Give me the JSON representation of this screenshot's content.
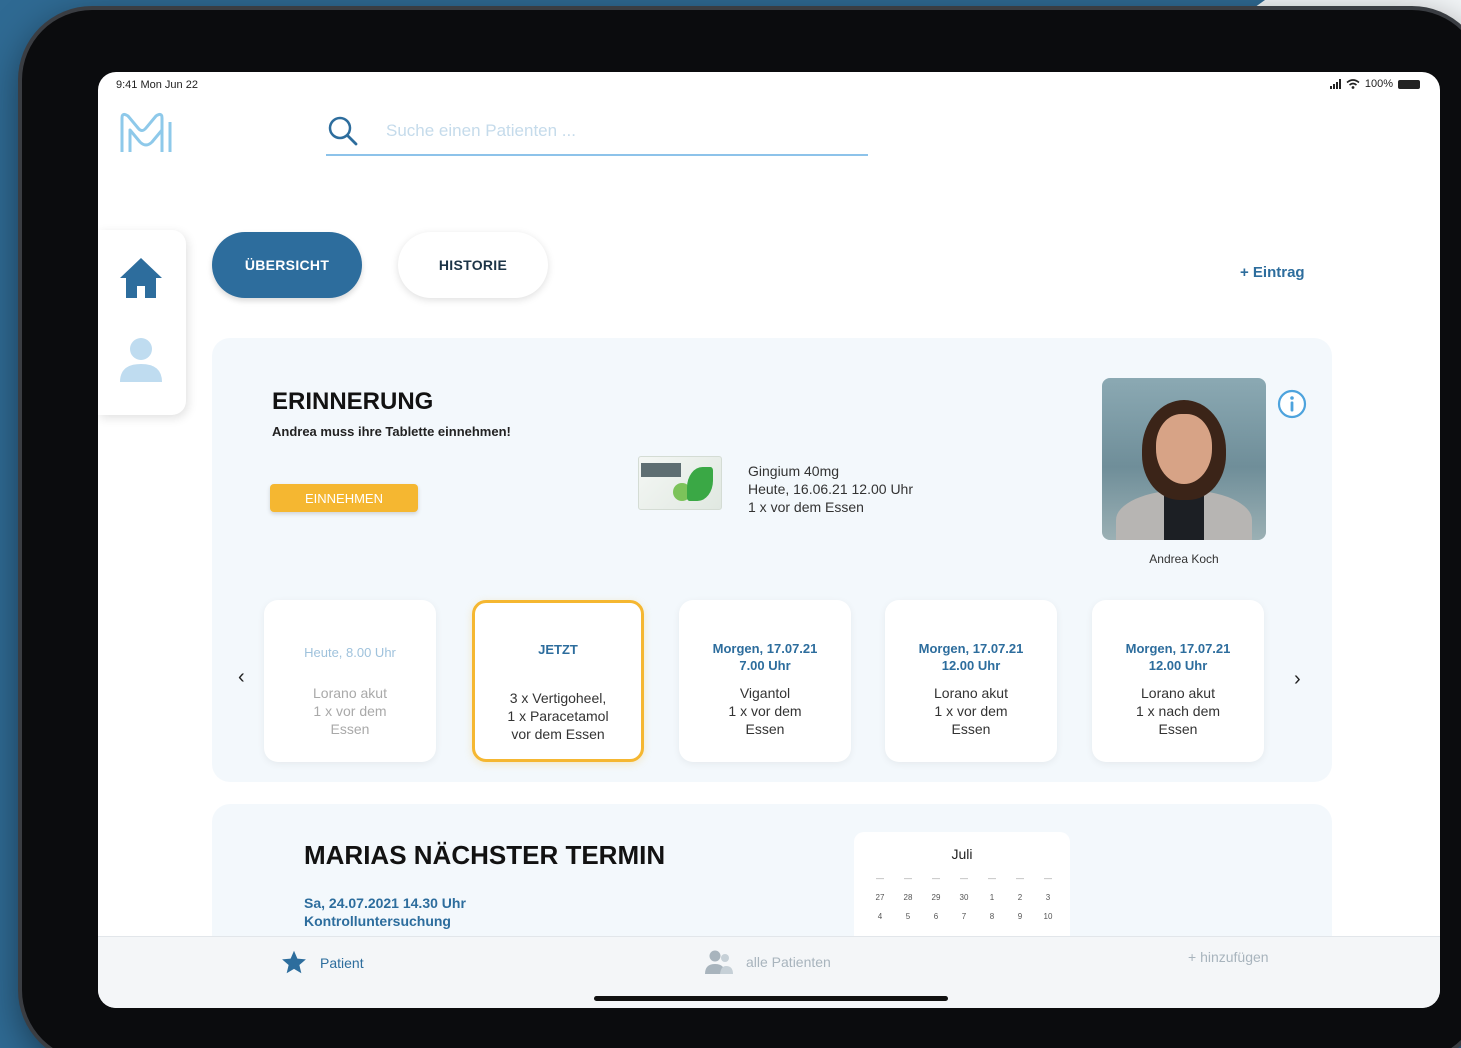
{
  "status_bar": {
    "time": "9:41  Mon Jun 22",
    "battery": "100%"
  },
  "search": {
    "placeholder": "Suche einen Patienten ..."
  },
  "tabs": [
    {
      "label": "ÜBERSICHT",
      "active": true
    },
    {
      "label": "HISTORIE",
      "active": false
    }
  ],
  "add_entry": {
    "label": "+ Eintrag"
  },
  "reminder": {
    "title": "ERINNERUNG",
    "subtitle": "Andrea muss ihre Tablette einnehmen!",
    "button_label": "EINNEHMEN",
    "medication": {
      "name": "Gingium 40mg",
      "time": "Heute, 16.06.21 12.00 Uhr",
      "dose": "1 x vor dem Essen"
    },
    "patient_name": "Andrea Koch"
  },
  "schedule": [
    {
      "when": "Heute, 8.00 Uhr",
      "what": "Lorano akut\n1 x vor dem\nEssen",
      "state": "past"
    },
    {
      "when": "JETZT",
      "what": "3 x Vertigoheel,\n1 x Paracetamol\nvor dem Essen",
      "state": "current"
    },
    {
      "when": "Morgen, 17.07.21\n7.00 Uhr",
      "what": "Vigantol\n1 x vor dem\nEssen",
      "state": "upcoming"
    },
    {
      "when": "Morgen, 17.07.21\n12.00 Uhr",
      "what": "Lorano akut\n1 x vor dem\nEssen",
      "state": "upcoming"
    },
    {
      "when": "Morgen, 17.07.21\n12.00 Uhr",
      "what": "Lorano akut\n1 x nach dem\nEssen",
      "state": "upcoming"
    }
  ],
  "appointment": {
    "title": "MARIAS NÄCHSTER TERMIN",
    "date": "Sa, 24.07.2021 14.30 Uhr",
    "type": "Kontrolluntersuchung",
    "calendar_month": "Juli",
    "calendar_days": [
      "27",
      "28",
      "29",
      "30",
      "1",
      "2",
      "3",
      "4",
      "5",
      "6",
      "7",
      "8",
      "9",
      "10"
    ]
  },
  "bottom_nav": {
    "patient": "Patient",
    "all_patients": "alle Patienten",
    "add": "+ hinzufügen"
  },
  "colors": {
    "primary": "#2d6d9d",
    "accent": "#f5b731",
    "card_bg": "#f3f8fc"
  }
}
